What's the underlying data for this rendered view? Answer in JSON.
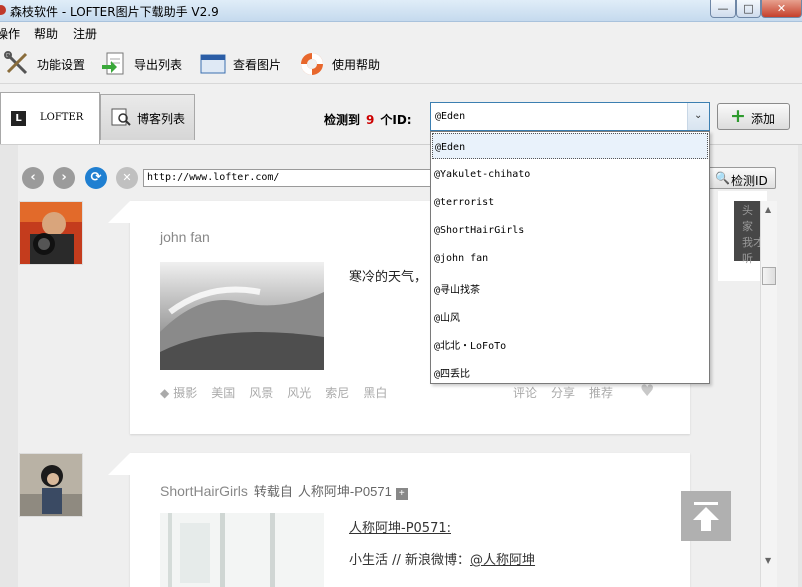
{
  "window": {
    "title": "森枝软件 - LOFTER图片下载助手 V2.9",
    "minimize": "—",
    "maximize": "□",
    "close": "✕"
  },
  "menu": [
    "操作",
    "帮助",
    "注册"
  ],
  "toolbar": [
    {
      "label": "功能设置",
      "icon": "wrench-screwdriver-icon"
    },
    {
      "label": "导出列表",
      "icon": "export-document-icon"
    },
    {
      "label": "查看图片",
      "icon": "window-icon"
    },
    {
      "label": "使用帮助",
      "icon": "lifebuoy-icon"
    }
  ],
  "tabs": {
    "lofter": {
      "icon_letter": "L",
      "label": "LOFTER"
    },
    "blogs": {
      "label": "博客列表"
    }
  },
  "detect": {
    "prefix": "检测到",
    "count": "9",
    "suffix": "个ID:"
  },
  "combo": {
    "value": "@Eden",
    "arrow": "⌄"
  },
  "add_button": {
    "plus": "+",
    "label": "添加"
  },
  "dropdown": {
    "items": [
      "@Eden",
      "@Yakulet-chihato",
      "@terrorist",
      "@ShortHairGirls",
      "@john fan",
      "@寻山找茶",
      "@山风",
      "@北北・LoFoTo",
      "@四丢比"
    ],
    "selected_index": 0
  },
  "browser": {
    "nav": {
      "back": "‹",
      "forward": "›",
      "refresh": "⟳",
      "stop": "✕"
    },
    "url": "http://www.lofter.com/",
    "detect_button": {
      "icon": "🔍",
      "label": "检测ID"
    }
  },
  "posts": [
    {
      "author": "john fan",
      "excerpt": "寒冷的天气，",
      "tags": [
        "摄影",
        "美国",
        "风景",
        "风光",
        "索尼",
        "黑白"
      ],
      "tag_icon": "◆",
      "actions": [
        "评论",
        "分享",
        "推荐"
      ],
      "heart": "♥"
    },
    {
      "author": "ShortHairGirls",
      "via": "转载自",
      "source": "人称阿坤-P0571",
      "plus": "+",
      "link": "人称阿坤-P0571:",
      "line2_prefix": "小生活 // 新浪微博：",
      "line2_at": "@人称阿坤"
    }
  ],
  "sidecard": {
    "lines": [
      "头",
      "家",
      "我才",
      "听"
    ]
  },
  "colors": {
    "accent": "#3c7fb1",
    "count_red": "#cc0000",
    "plus_green": "#2e9b2e"
  }
}
